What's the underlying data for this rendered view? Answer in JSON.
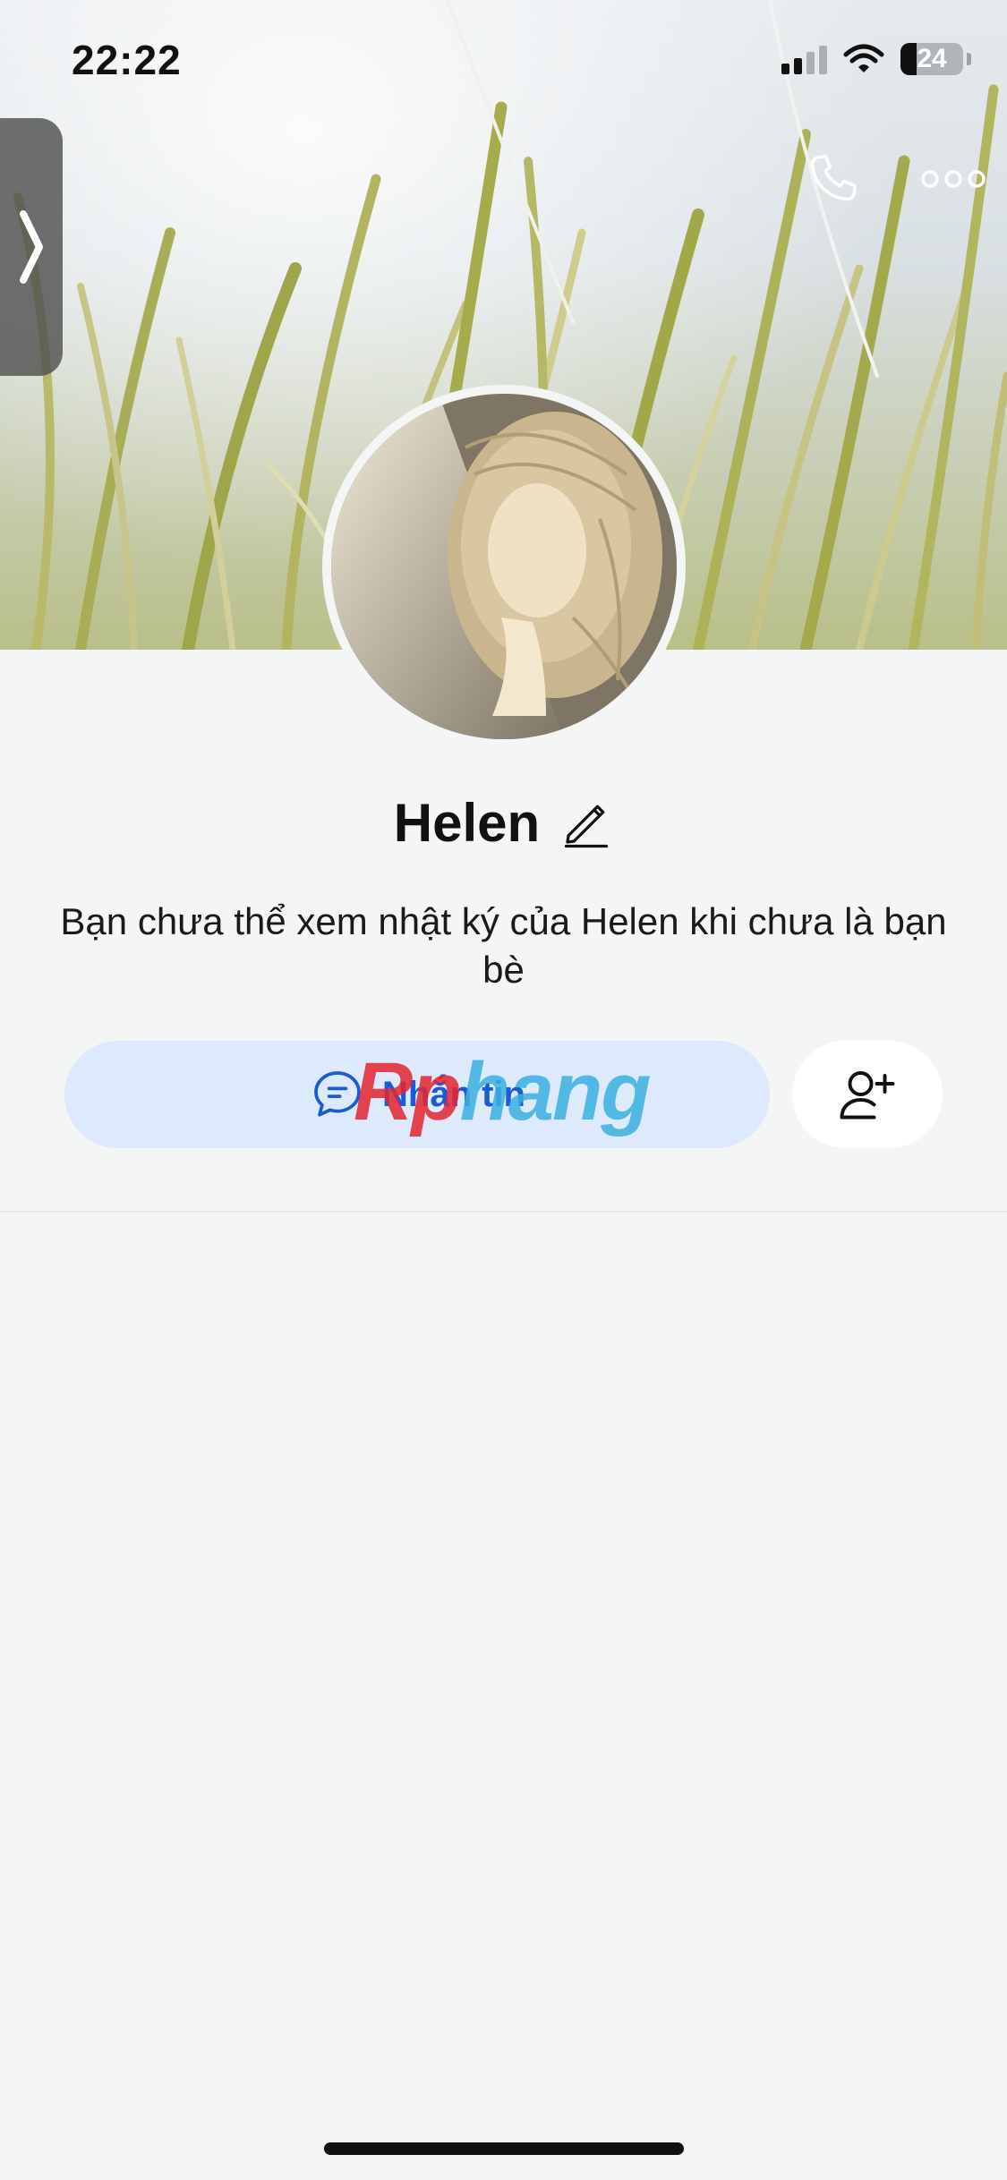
{
  "status_bar": {
    "time": "22:22",
    "battery_level": "24"
  },
  "header": {
    "call_icon": "phone-icon",
    "more_icon": "more-horizontal-icon",
    "side_tab_icon": "chevron-right-icon"
  },
  "profile": {
    "name": "Helen",
    "edit_icon": "pencil-icon",
    "notice": "Bạn chưa thể xem nhật ký của Helen khi chưa là bạn bè"
  },
  "actions": {
    "message_label": "Nhắn tin",
    "message_icon": "chat-bubble-icon",
    "add_friend_icon": "add-friend-icon"
  },
  "watermark": {
    "part_a": "Rp",
    "part_b": "hang"
  },
  "colors": {
    "accent": "#1c5bd8",
    "message_button_bg": "#dde9fd",
    "page_bg": "#f4f5f5"
  }
}
